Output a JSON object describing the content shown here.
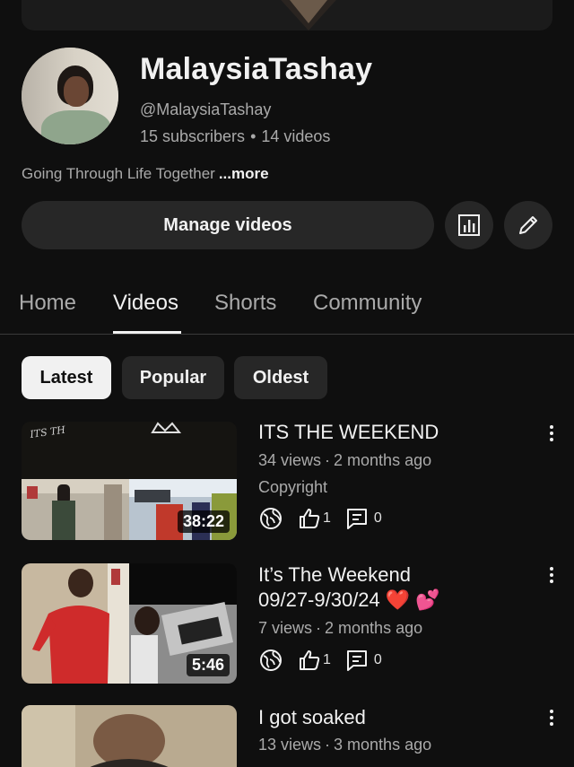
{
  "channel": {
    "name": "MalaysiaTashay",
    "handle": "@MalaysiaTashay",
    "subscribers": "15 subscribers",
    "videos_count": "14 videos",
    "stats_separator": "•",
    "description": "Going Through Life Together",
    "more_label": "...more"
  },
  "actions": {
    "manage_videos": "Manage videos",
    "analytics_icon": "bar-chart-icon",
    "edit_icon": "pencil-icon"
  },
  "tabs": [
    {
      "label": "Home",
      "active": false
    },
    {
      "label": "Videos",
      "active": true
    },
    {
      "label": "Shorts",
      "active": false
    },
    {
      "label": "Community",
      "active": false
    }
  ],
  "filters": [
    {
      "label": "Latest",
      "selected": true
    },
    {
      "label": "Popular",
      "selected": false
    },
    {
      "label": "Oldest",
      "selected": false
    }
  ],
  "videos": [
    {
      "title": "ITS THE WEEKEND",
      "views": "34 views",
      "age": "2 months ago",
      "meta_separator": "·",
      "extra": "Copyright",
      "duration": "38:22",
      "likes": "1",
      "comments": "0",
      "thumb_text": "ITS TH"
    },
    {
      "title_line1": "It’s The Weekend",
      "title_line2": "09/27-9/30/24 ❤️ 💕",
      "views": "7 views",
      "age": "2 months ago",
      "meta_separator": "·",
      "duration": "5:46",
      "likes": "1",
      "comments": "0"
    },
    {
      "title": "I got soaked",
      "views": "13 views",
      "age": "3 months ago",
      "meta_separator": "·"
    }
  ],
  "colors": {
    "background": "#0f0f0f",
    "surface": "#272727",
    "text_primary": "#f1f1f1",
    "text_secondary": "#aaaaaa"
  }
}
